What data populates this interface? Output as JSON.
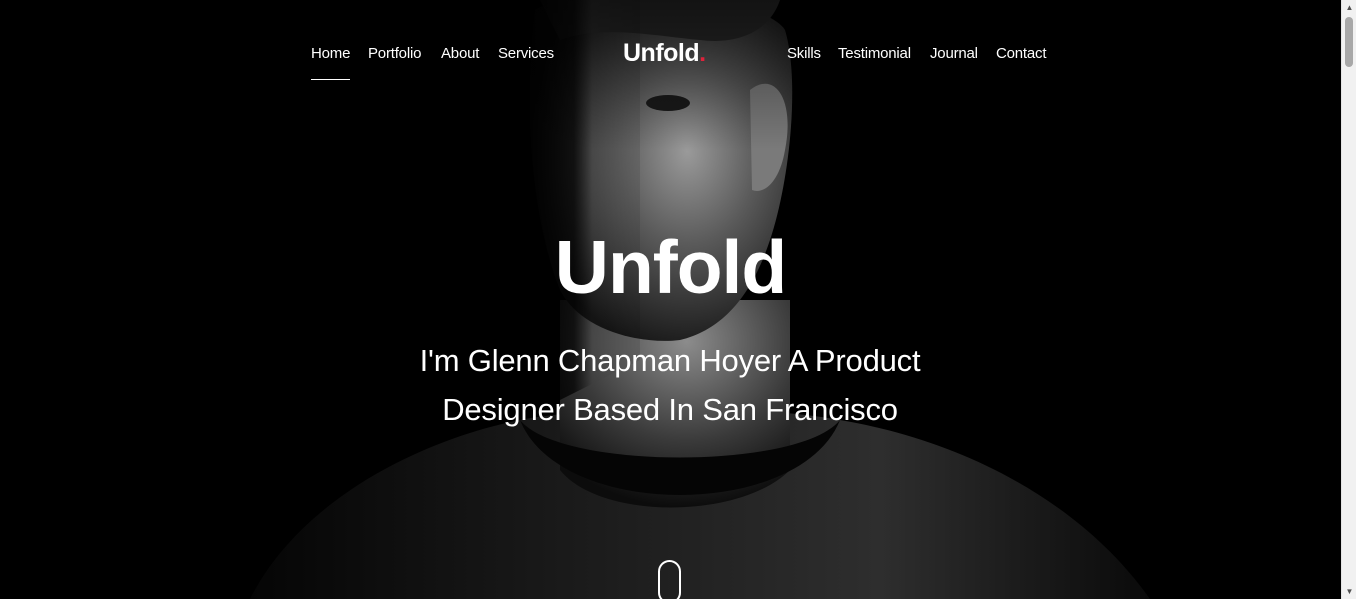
{
  "nav": {
    "left_items": [
      {
        "label": "Home",
        "active": true
      },
      {
        "label": "Portfolio",
        "active": false
      },
      {
        "label": "About",
        "active": false
      },
      {
        "label": "Services",
        "active": false
      }
    ],
    "brand": {
      "text": "Unfold",
      "dot": ".",
      "dot_color": "#e0223b"
    },
    "right_items": [
      {
        "label": "Skills"
      },
      {
        "label": "Testimonial"
      },
      {
        "label": "Journal"
      },
      {
        "label": "Contact"
      }
    ]
  },
  "hero": {
    "title": "Unfold",
    "subtitle": "I'm Glenn Chapman Hoyer A Product Designer Based In San Francisco",
    "background_color": "#000000",
    "text_color": "#ffffff",
    "scroll_icon": "mouse-scroll-icon"
  },
  "scrollbar": {
    "up_icon": "scroll-up-arrow-icon",
    "down_icon": "scroll-down-arrow-icon"
  }
}
